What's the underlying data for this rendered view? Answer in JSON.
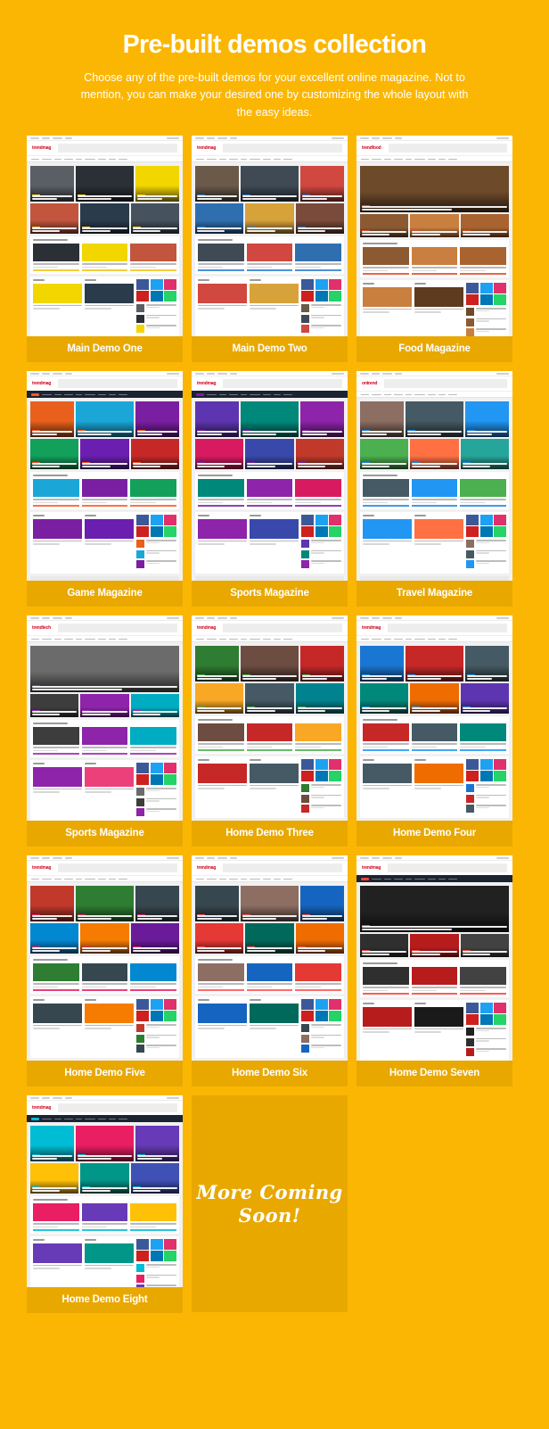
{
  "hero": {
    "title": "Pre-built demos collection",
    "subtitle": "Choose any of the pre-built demos for your excellent online magazine. Not to mention, you can make your desired one by customizing the whole layout with the easy ideas."
  },
  "theme": {
    "page_background": "#FBB603",
    "card_background": "#E8A800",
    "label_text": "#FFFFFF",
    "heading_text": "#FFFFFF"
  },
  "coming_soon": {
    "line1": "More Coming",
    "line2": "Soon!"
  },
  "demos": [
    {
      "label": "Main Demo One",
      "brand": "trendmag",
      "style": "light",
      "accent": "#F5C518",
      "hero_kind": "six-tile",
      "palette": [
        "#5a5f66",
        "#2b2f36",
        "#f2d600",
        "#c2553d",
        "#2a3b4c",
        "#46525e"
      ]
    },
    {
      "label": "Main Demo Two",
      "brand": "trendmag",
      "style": "light",
      "accent": "#2E7DD1",
      "hero_kind": "six-tile",
      "palette": [
        "#6b5a4a",
        "#3f4a55",
        "#d0483f",
        "#2f6fb0",
        "#d8a23b",
        "#7a4a3a"
      ]
    },
    {
      "label": "Food Magazine",
      "brand": "trendfood",
      "style": "light",
      "accent": "#E04B2A",
      "hero_kind": "wide-photo",
      "palette": [
        "#6d4a2a",
        "#8b5a33",
        "#c97f3f",
        "#a9632f",
        "#5e3a1e",
        "#7e4e28"
      ]
    },
    {
      "label": "Game Magazine",
      "brand": "trendmag",
      "style": "dark",
      "accent": "#FF5722",
      "hero_kind": "six-tile",
      "palette": [
        "#e8601c",
        "#1aa7d8",
        "#7b1fa2",
        "#12a05a",
        "#6a1fb0",
        "#c62828"
      ]
    },
    {
      "label": "Sports Magazine",
      "brand": "trendmag",
      "style": "dark",
      "accent": "#7B1FA2",
      "hero_kind": "six-tile",
      "palette": [
        "#5e35b1",
        "#00897b",
        "#8e24aa",
        "#d81b60",
        "#3949ab",
        "#c0392b"
      ]
    },
    {
      "label": "Travel Magazine",
      "brand": "ontrend",
      "style": "light",
      "accent": "#1E88E5",
      "hero_kind": "six-tile",
      "palette": [
        "#8d6e63",
        "#455a64",
        "#2196f3",
        "#4caf50",
        "#ff7043",
        "#26a69a"
      ]
    },
    {
      "label": "Sports Magazine",
      "brand": "trendtech",
      "style": "light",
      "accent": "#9C27B0",
      "hero_kind": "wide-photo",
      "palette": [
        "#6b6b6b",
        "#3d3d3d",
        "#8e24aa",
        "#00acc1",
        "#ec407a",
        "#1e88e5"
      ]
    },
    {
      "label": "Home Demo Three",
      "brand": "trendmag",
      "style": "light",
      "accent": "#4CAF50",
      "hero_kind": "six-tile",
      "palette": [
        "#2e7d32",
        "#6d4c41",
        "#c62828",
        "#f9a825",
        "#455a64",
        "#00838f"
      ]
    },
    {
      "label": "Home Demo Four",
      "brand": "trendmag",
      "style": "light",
      "accent": "#2196F3",
      "hero_kind": "six-tile",
      "palette": [
        "#1976d2",
        "#c62828",
        "#455a64",
        "#00897b",
        "#ef6c00",
        "#5e35b1"
      ]
    },
    {
      "label": "Home Demo Five",
      "brand": "trendmag",
      "style": "light",
      "accent": "#E91E63",
      "hero_kind": "six-tile",
      "palette": [
        "#c0392b",
        "#2e7d32",
        "#37474f",
        "#0288d1",
        "#f57c00",
        "#6a1b9a"
      ]
    },
    {
      "label": "Home Demo Six",
      "brand": "trendmag",
      "style": "light",
      "accent": "#FF5252",
      "hero_kind": "six-tile",
      "palette": [
        "#37474f",
        "#8d6e63",
        "#1565c0",
        "#e53935",
        "#00695c",
        "#ef6c00"
      ]
    },
    {
      "label": "Home Demo Seven",
      "brand": "trendmag",
      "style": "dark",
      "accent": "#F44336",
      "hero_kind": "wide-photo",
      "palette": [
        "#212121",
        "#2f2f2f",
        "#b71c1c",
        "#424242",
        "#1a1a1a",
        "#616161"
      ]
    },
    {
      "label": "Home Demo Eight",
      "brand": "trendmag",
      "style": "dark",
      "accent": "#00BCD4",
      "hero_kind": "six-tile",
      "palette": [
        "#00bcd4",
        "#e91e63",
        "#673ab7",
        "#ffc107",
        "#009688",
        "#3f51b5"
      ]
    }
  ]
}
